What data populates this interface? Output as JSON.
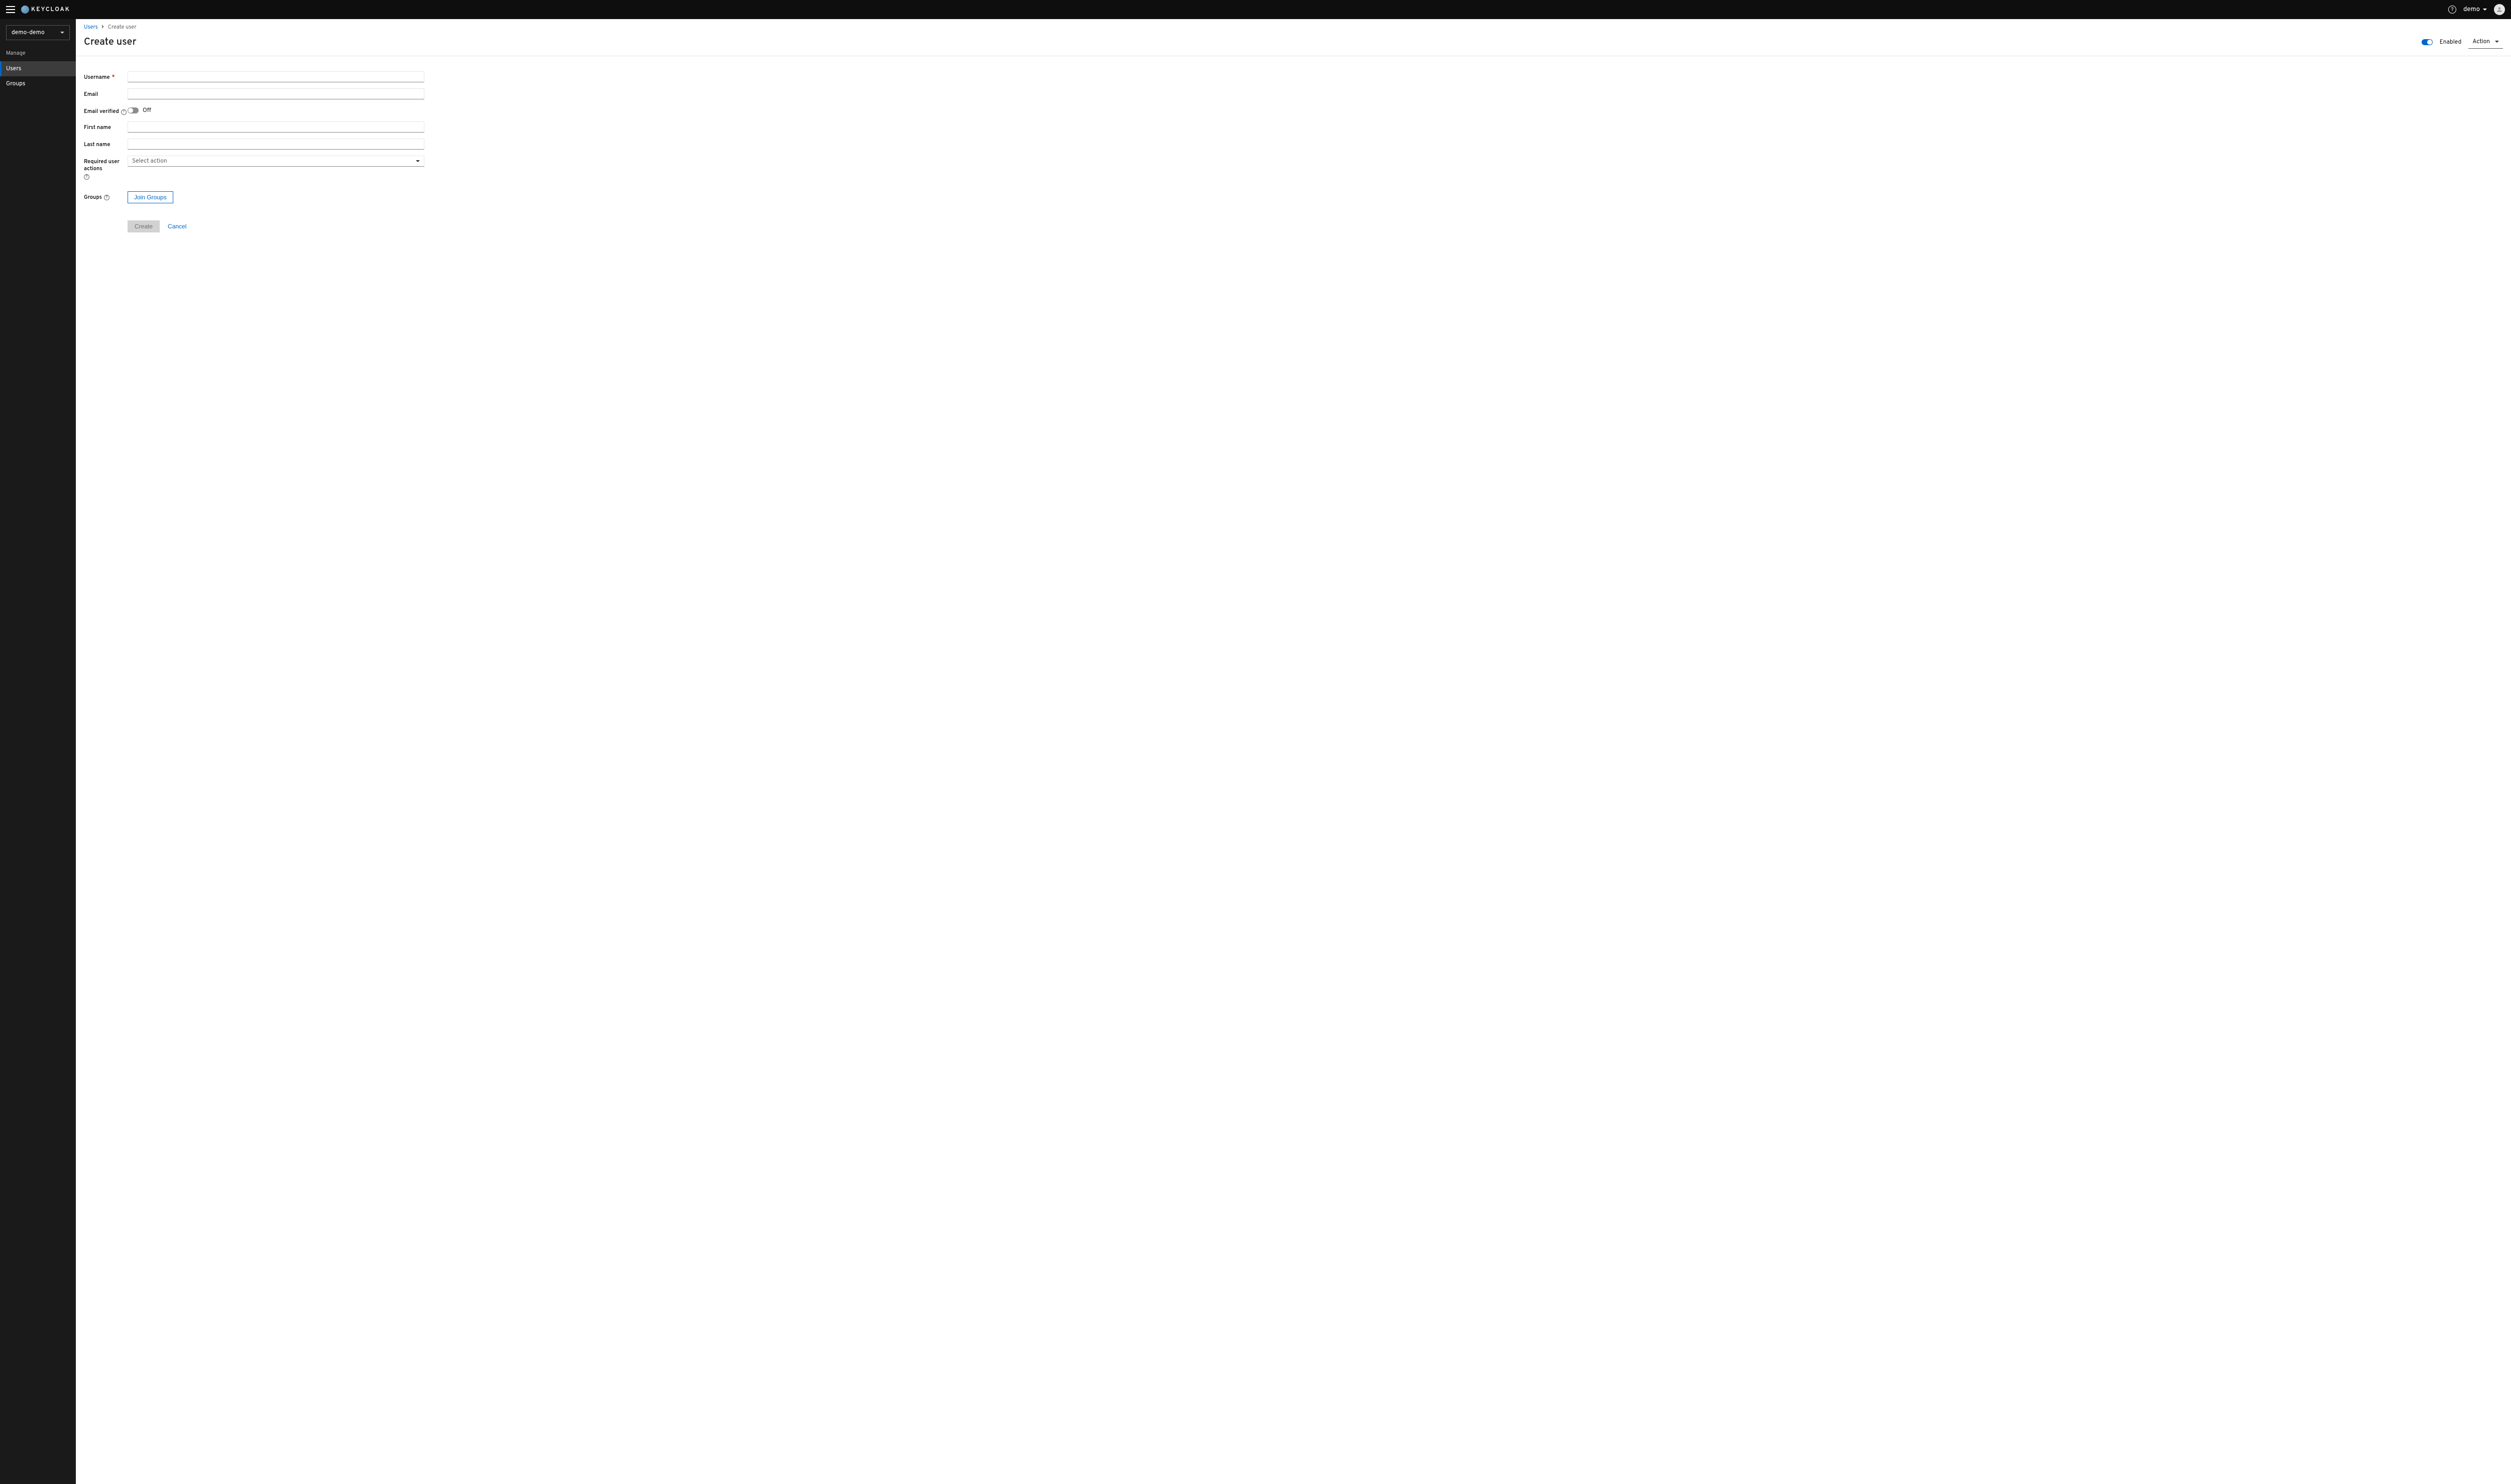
{
  "header": {
    "brand": "KEYCLOAK",
    "user": "demo"
  },
  "sidebar": {
    "realm": "demo-demo",
    "section_label": "Manage",
    "items": [
      {
        "label": "Users",
        "active": true
      },
      {
        "label": "Groups",
        "active": false
      }
    ]
  },
  "breadcrumb": {
    "parent": "Users",
    "current": "Create user"
  },
  "page": {
    "title": "Create user",
    "enabled_label": "Enabled",
    "action_label": "Action"
  },
  "form": {
    "username_label": "Username",
    "email_label": "Email",
    "email_verified_label": "Email verified",
    "email_verified_value": "Off",
    "first_name_label": "First name",
    "last_name_label": "Last name",
    "required_actions_label": "Required user actions",
    "required_actions_placeholder": "Select action",
    "groups_label": "Groups",
    "join_groups_button": "Join Groups",
    "create_button": "Create",
    "cancel_button": "Cancel",
    "username_value": "",
    "email_value": "",
    "first_name_value": "",
    "last_name_value": ""
  }
}
